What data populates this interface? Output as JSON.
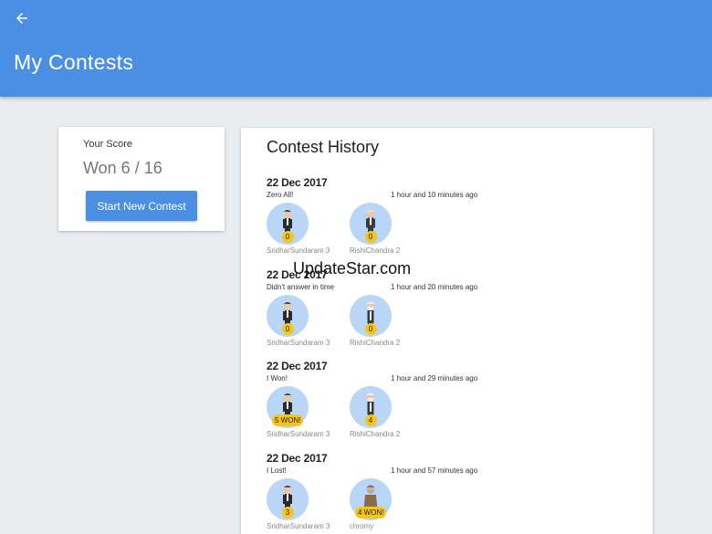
{
  "appbar": {
    "title": "My Contests"
  },
  "score": {
    "label": "Your Score",
    "value": "Won 6 / 16",
    "button_label": "Start New Contest"
  },
  "history": {
    "title": "Contest History",
    "entries": [
      {
        "date": "22 Dec 2017",
        "status": "Zero All!",
        "time": "1 hour and 10 minutes ago",
        "players": [
          {
            "name": "SridharSundaram 3",
            "badge": "0",
            "figure": "suit"
          },
          {
            "name": "RishiChandra 2",
            "badge": "0",
            "figure": "suit-white"
          }
        ]
      },
      {
        "date": "22 Dec 2017",
        "status": "Didn't answer in time",
        "time": "1 hour and 20 minutes ago",
        "players": [
          {
            "name": "SridharSundaram 3",
            "badge": "0",
            "figure": "suit"
          },
          {
            "name": "RishiChandra 2",
            "badge": "0",
            "figure": "bearded"
          }
        ]
      },
      {
        "date": "22 Dec 2017",
        "status": "I Won!",
        "time": "1 hour and 29 minutes ago",
        "players": [
          {
            "name": "SridharSundaram 3",
            "badge": "5 WON!",
            "figure": "suit"
          },
          {
            "name": "RishiChandra 2",
            "badge": "4",
            "figure": "bearded"
          }
        ]
      },
      {
        "date": "22 Dec 2017",
        "status": "I Lost!",
        "time": "1 hour and 57 minutes ago",
        "players": [
          {
            "name": "SridharSundaram 3",
            "badge": "3",
            "figure": "suit"
          },
          {
            "name": "chromy",
            "badge": "4 WON!",
            "figure": "robed"
          }
        ]
      }
    ]
  },
  "watermark": "UpdateStar.com",
  "colors": {
    "appbar": "#4a8fe2",
    "avatar_bg": "#b9d6f6",
    "badge": "#f5c518",
    "background": "#e9edf0"
  }
}
